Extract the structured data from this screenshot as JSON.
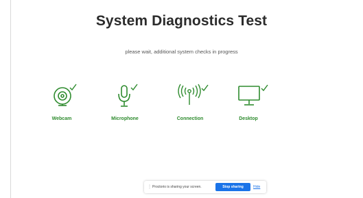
{
  "page": {
    "title": "System Diagnostics Test",
    "subtitle": "please wait, additional system checks in progress"
  },
  "checks": [
    {
      "label": "Webcam",
      "icon": "webcam-icon",
      "status": "passed"
    },
    {
      "label": "Microphone",
      "icon": "microphone-icon",
      "status": "passed"
    },
    {
      "label": "Connection",
      "icon": "connection-icon",
      "status": "passed"
    },
    {
      "label": "Desktop",
      "icon": "desktop-icon",
      "status": "passed"
    }
  ],
  "share_bar": {
    "message": "Proctorio is sharing your screen.",
    "stop_label": "Stop sharing",
    "hide_label": "Hide"
  },
  "colors": {
    "accent_green": "#2e8b2e",
    "share_button_blue": "#1a73e8"
  }
}
